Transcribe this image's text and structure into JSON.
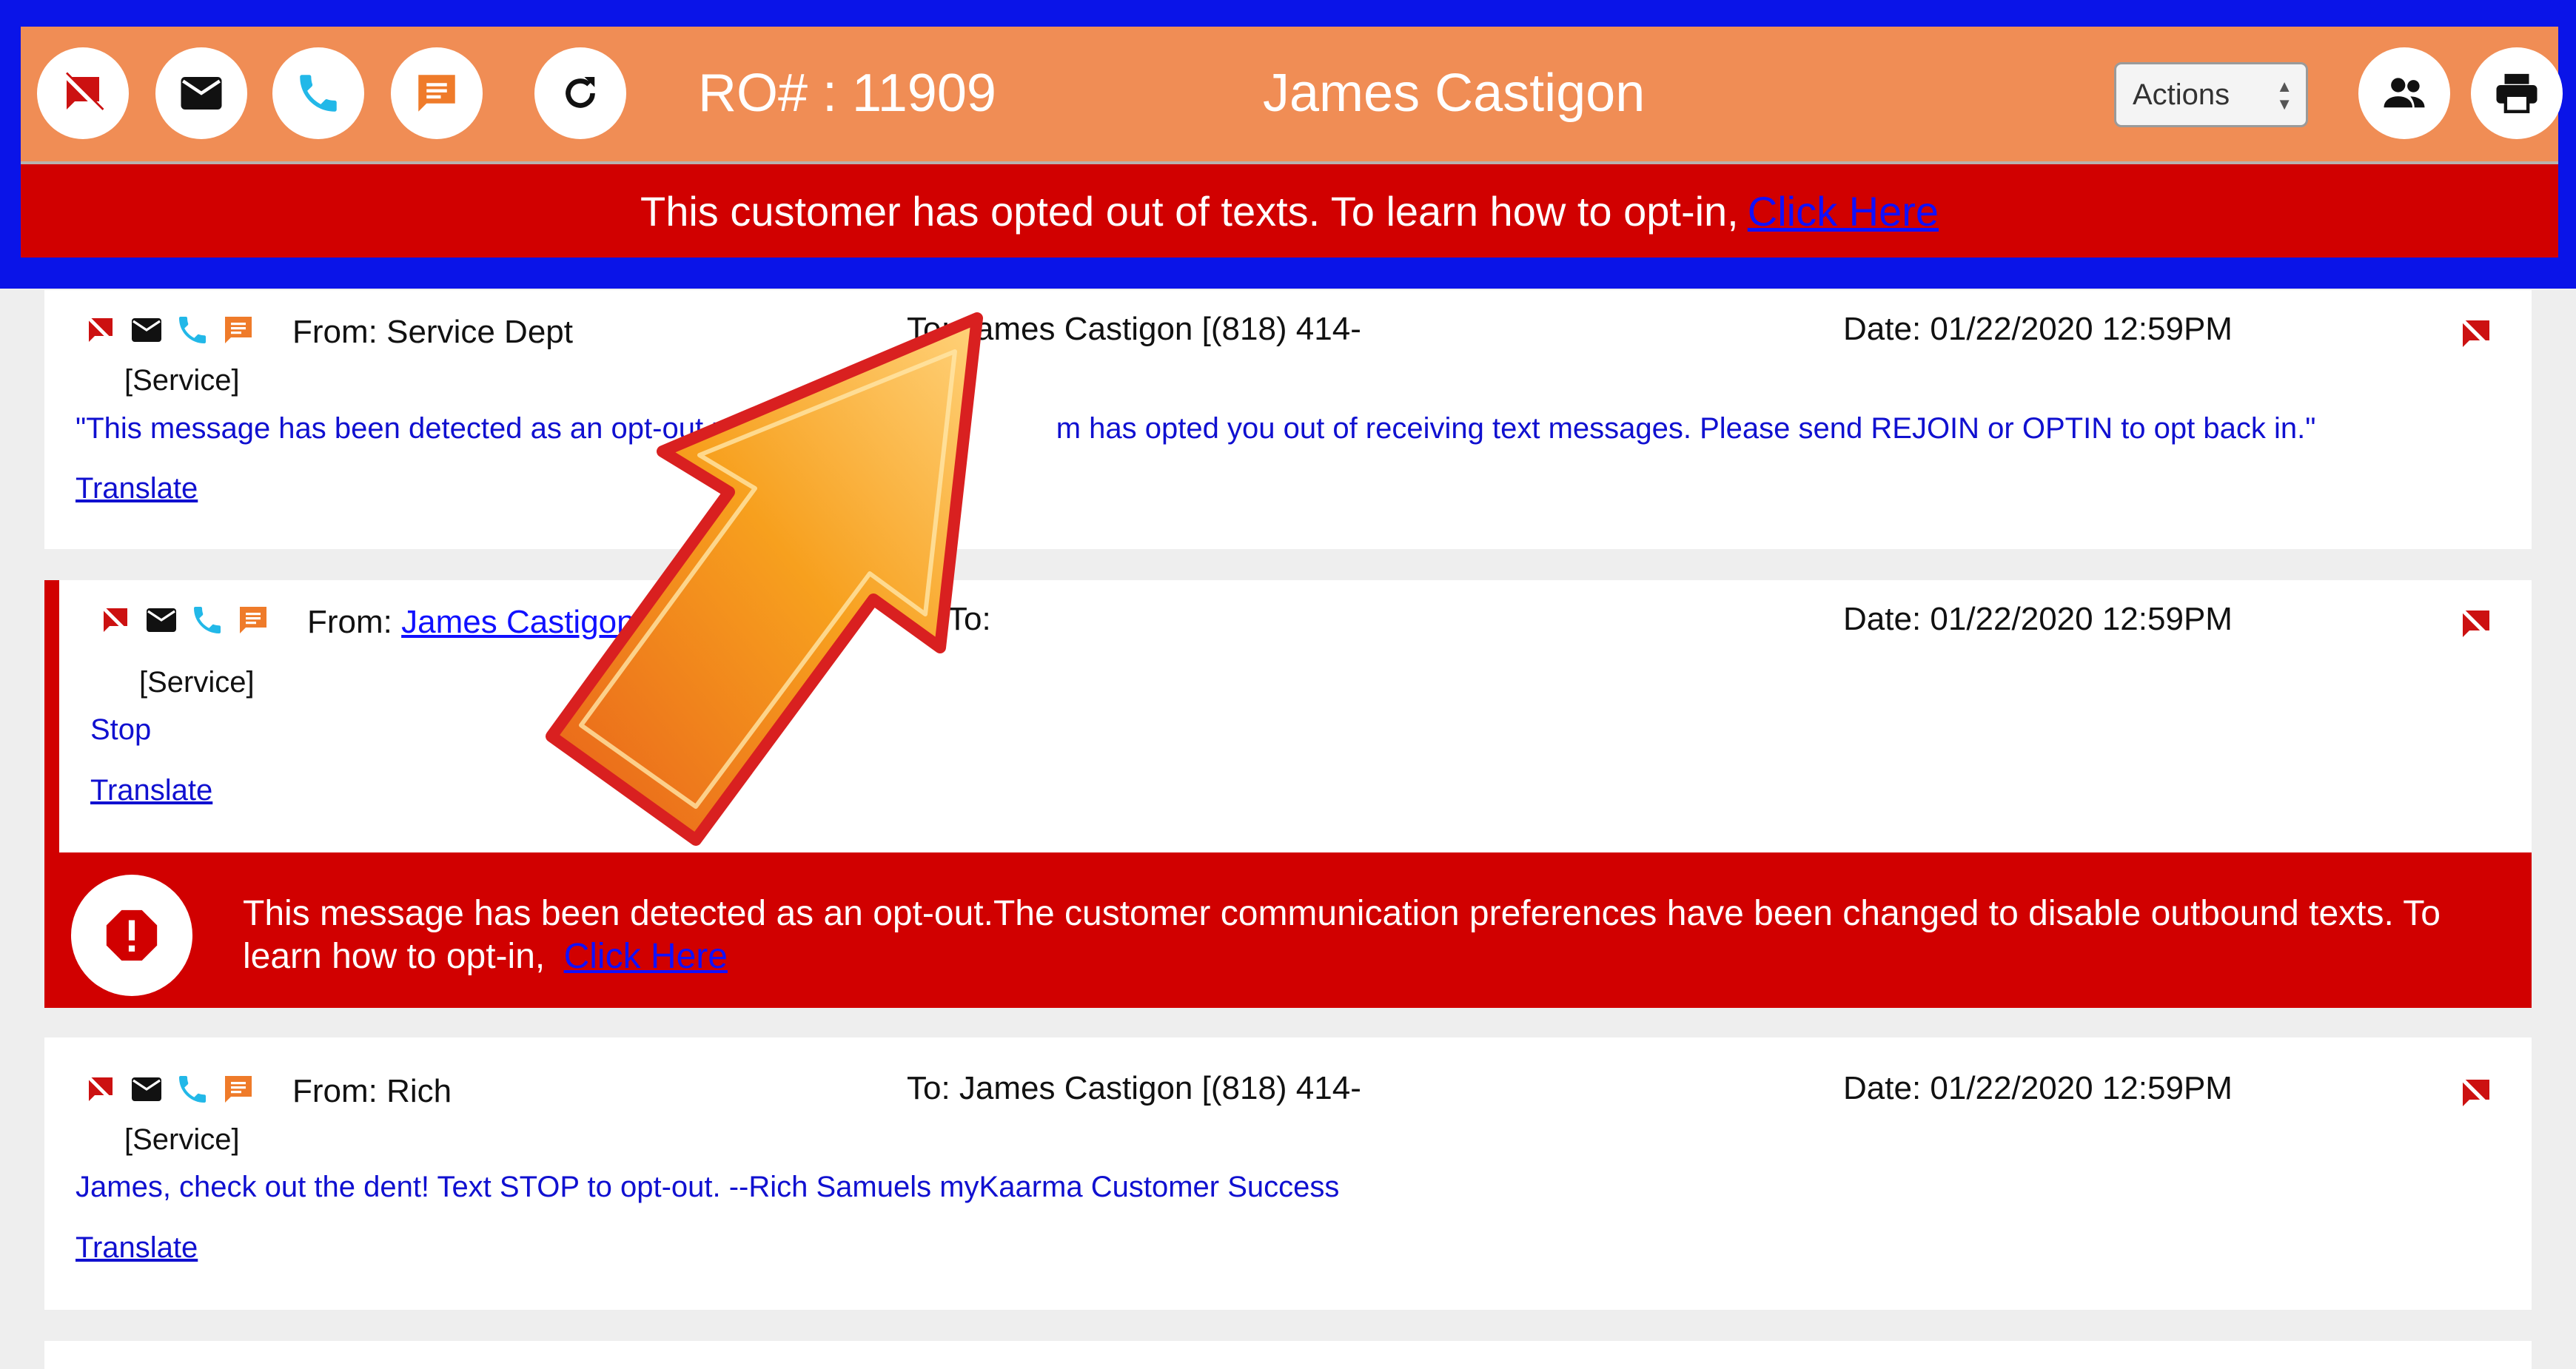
{
  "header": {
    "ro_label": "RO# : 11909",
    "customer_name": "James Castigon",
    "actions_label": "Actions",
    "opt_out_banner": "This customer has opted out of texts. To learn how to opt-in,",
    "opt_out_link": "Click Here"
  },
  "messages": [
    {
      "from": "From: Service Dept",
      "to": "To: James Castigon [(818) 414-",
      "date": "Date: 01/22/2020 12:59PM",
      "service": "[Service]",
      "body_start": "\"This message has been detected as an opt-out r",
      "body_end": "m has opted you out of receiving text messages. Please send REJOIN or OPTIN to opt back in.\"",
      "translate": "Translate"
    },
    {
      "from_label": "From:",
      "from_link": "James Castigon[(",
      "to": "To:",
      "date": "Date: 01/22/2020 12:59PM",
      "service": "[Service]",
      "body": "Stop",
      "translate": "Translate"
    },
    {
      "from": "From: Rich",
      "to": "To: James Castigon [(818) 414-",
      "date": "Date: 01/22/2020 12:59PM",
      "service": "[Service]",
      "body": "James, check out the dent! Text STOP to opt-out. --Rich Samuels myKaarma Customer Success",
      "translate": "Translate"
    }
  ],
  "alert": {
    "text": "This message has been detected as an opt-out.The customer communication preferences have been changed to disable outbound texts. To learn how to opt-in,",
    "link": "Click Here"
  },
  "colors": {
    "header_bg": "#f08d55",
    "frame": "#0a14e8",
    "alert_red": "#d10000",
    "link_blue": "#1010ff",
    "icon_red": "#cc1111",
    "phone_cyan": "#22b8e8",
    "chat_orange": "#ef7b2a"
  },
  "icons": [
    "no-text-icon",
    "mail-icon",
    "phone-icon",
    "chat-icon",
    "refresh-icon",
    "group-icon",
    "print-icon",
    "alert-octagon-icon",
    "arrow-pointer"
  ]
}
